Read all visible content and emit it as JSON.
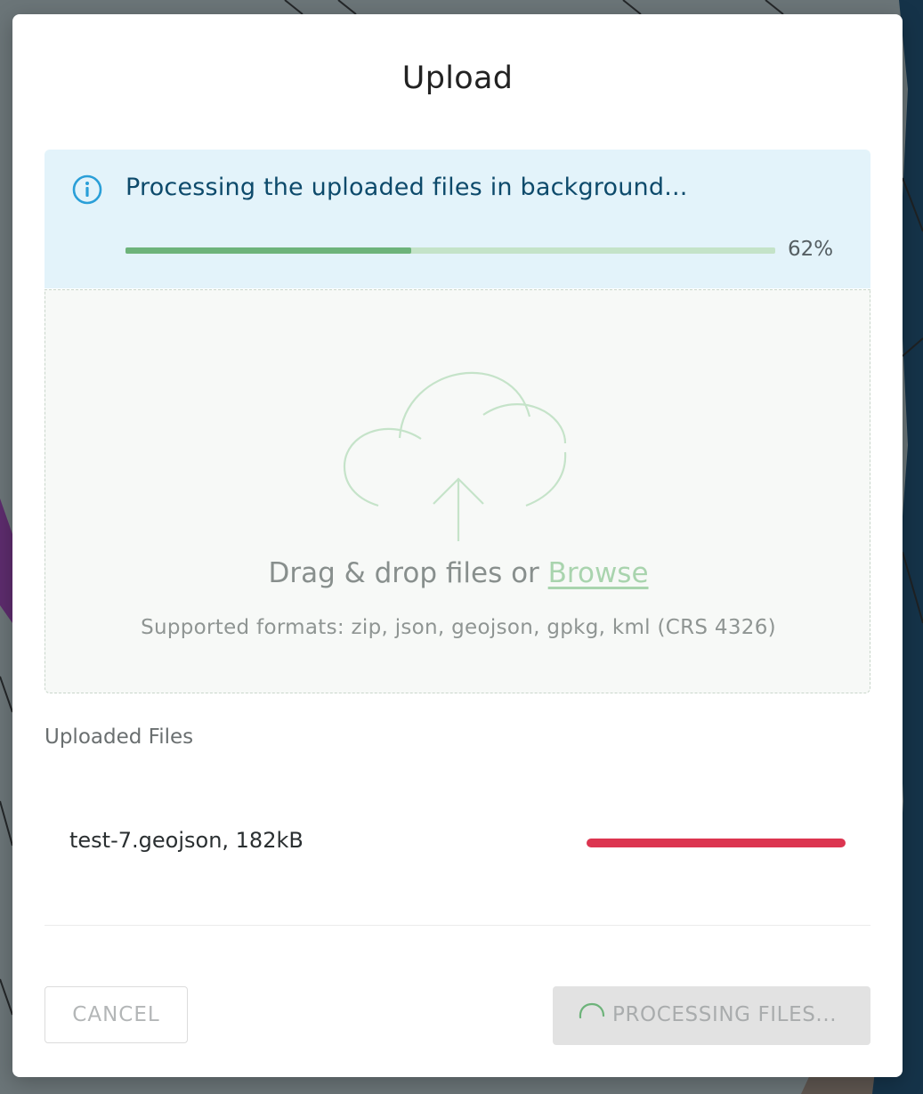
{
  "modal": {
    "title": "Upload"
  },
  "banner": {
    "icon": "info-circle-icon",
    "message": "Processing the uploaded files in background...",
    "progress_percent": 62,
    "progress_label": "62%",
    "color": "#0d4a6b"
  },
  "dropzone": {
    "icon": "cloud-upload-icon",
    "prompt": "Drag & drop files or ",
    "browse_label": "Browse",
    "formats": "Supported formats: zip, json, geojson, gpkg, kml (CRS 4326)"
  },
  "files": {
    "heading": "Uploaded Files",
    "items": [
      {
        "label": "test-7.geojson, 182kB",
        "status_color": "#dc3550"
      }
    ]
  },
  "actions": {
    "cancel_label": "CANCEL",
    "processing_label": "PROCESSING FILES..."
  }
}
